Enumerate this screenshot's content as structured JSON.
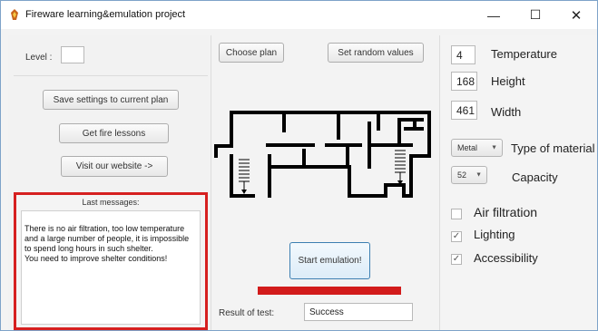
{
  "window": {
    "title": "Fireware learning&emulation project"
  },
  "left": {
    "level_label": "Level :",
    "level_value": "",
    "save_button": "Save settings to current plan",
    "lessons_button": "Get fire lessons",
    "website_button": "Visit our website ->",
    "messages_title": "Last messages:",
    "messages_lines": [
      "There is no air filtration, too low temperature and a large number of people, it is impossible to spend long hours in such shelter.",
      "You need to improve shelter conditions!"
    ]
  },
  "center": {
    "choose_plan_button": "Choose plan",
    "random_button": "Set random  values",
    "start_button": "Start emulation!",
    "progress_fraction": 1.0,
    "result_label": "Result of test:",
    "result_value": "Success"
  },
  "right": {
    "temperature_value": "4",
    "temperature_label": "Temperature",
    "height_value": "168",
    "height_label": "Height",
    "width_value": "461",
    "width_label": "Width",
    "material_value": "Metal",
    "material_label": "Type of material",
    "capacity_value": "52",
    "capacity_label": "Capacity",
    "air_filtration_label": "Air filtration",
    "air_filtration_checked": false,
    "lighting_label": "Lighting",
    "lighting_checked": true,
    "accessibility_label": "Accessibility",
    "accessibility_checked": true
  },
  "colors": {
    "accent_red": "#d21b1b",
    "window_border": "#7ea3c9"
  }
}
